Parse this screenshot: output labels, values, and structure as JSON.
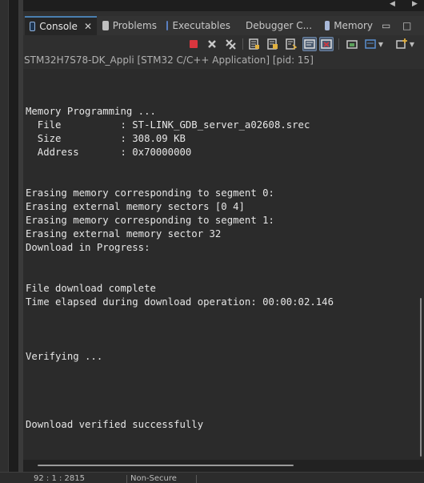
{
  "tabs": [
    {
      "label": "Console",
      "icon": "console-icon",
      "active": true,
      "closable": true
    },
    {
      "label": "Problems",
      "icon": "problems-icon",
      "active": false
    },
    {
      "label": "Executables",
      "icon": "executables-icon",
      "active": false
    },
    {
      "label": "Debugger C...",
      "icon": "debugger-console-icon",
      "active": false
    },
    {
      "label": "Memory",
      "icon": "memory-icon",
      "active": false
    }
  ],
  "toolbar": {
    "buttons": [
      {
        "name": "terminate-icon",
        "color": "#d9363e"
      },
      {
        "name": "remove-launch-icon",
        "color": "#c8c8c8"
      },
      {
        "name": "remove-all-terminated-icon",
        "color": "#c8c8c8"
      },
      {
        "name": "clear-console-icon",
        "color": "#c8c8c8"
      },
      {
        "name": "scroll-lock-icon",
        "color": "#c8c8c8"
      },
      {
        "name": "word-wrap-icon",
        "color": "#c8c8c8"
      },
      {
        "name": "show-on-output-icon",
        "pressed": true
      },
      {
        "name": "show-on-error-icon",
        "pressed": true
      },
      {
        "name": "pin-console-icon",
        "color": "#5aa05a"
      },
      {
        "name": "display-console-icon",
        "color": "#5a8fd0"
      },
      {
        "name": "new-console-icon",
        "color": "#e0b040"
      }
    ]
  },
  "console": {
    "title": "STM32H7S78-DK_Appli [STM32 C/C++ Application] [pid: 15]",
    "lines": [
      "",
      "Memory Programming ...",
      "  File          : ST-LINK_GDB_server_a02608.srec",
      "  Size          : 308.09 KB",
      "  Address       : 0x70000000",
      "",
      "",
      "Erasing memory corresponding to segment 0:",
      "Erasing external memory sectors [0 4]",
      "Erasing memory corresponding to segment 1:",
      "Erasing external memory sector 32",
      "Download in Progress:",
      "",
      "",
      "File download complete",
      "Time elapsed during download operation: 00:00:02.146",
      "",
      "",
      "",
      "Verifying ...",
      "",
      "",
      "",
      "",
      "Download verified successfully"
    ]
  },
  "statusbar": {
    "position": "92 : 1 : 2815",
    "security": "Non-Secure"
  },
  "colors": {
    "accent": "#4a7fb0",
    "terminate": "#d9363e",
    "text": "#e6e6e6"
  }
}
